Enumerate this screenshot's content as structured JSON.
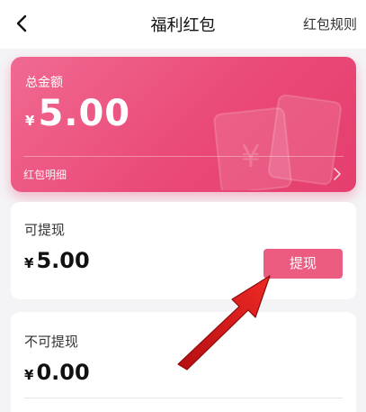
{
  "header": {
    "title": "福利红包",
    "rules_label": "红包规则",
    "back_icon": "chevron-left-icon"
  },
  "total_card": {
    "label": "总金额",
    "currency": "¥",
    "amount": "5.00",
    "detail_label": "红包明细",
    "detail_icon": "chevron-right-icon",
    "watermark_icon": "red-envelope-icon",
    "gradient_colors": [
      "#f06a91",
      "#e43e6d"
    ]
  },
  "withdrawable": {
    "label": "可提现",
    "currency": "¥",
    "amount": "5.00",
    "button_label": "提现",
    "button_color": "#ec5c80"
  },
  "non_withdrawable": {
    "label": "不可提现",
    "currency": "¥",
    "amount": "0.00"
  },
  "annotation": {
    "arrow_icon": "red-arrow-icon",
    "color": "#e01a1a"
  }
}
